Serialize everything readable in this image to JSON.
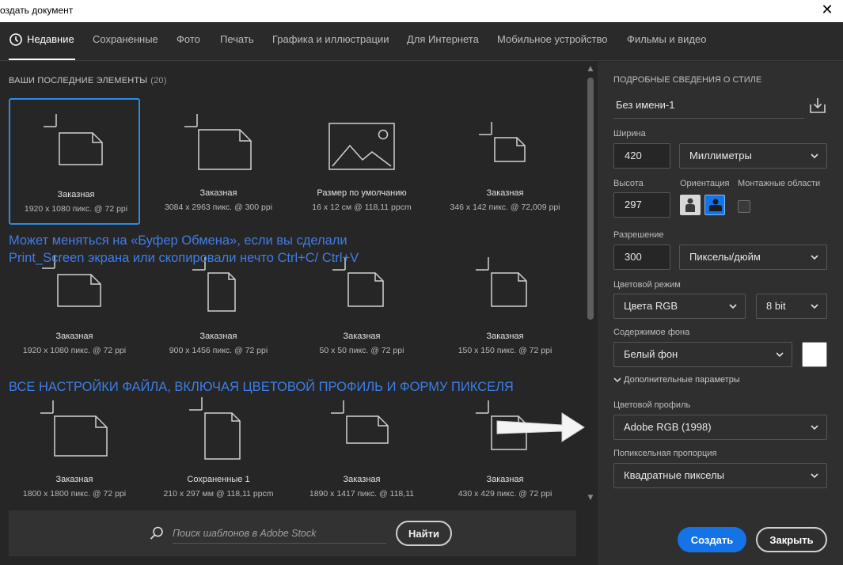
{
  "window": {
    "title": "оздать документ",
    "close_icon": "✕"
  },
  "tabs": [
    {
      "label": "Недавние",
      "active": true
    },
    {
      "label": "Сохраненные"
    },
    {
      "label": "Фото"
    },
    {
      "label": "Печать"
    },
    {
      "label": "Графика и иллюстрации"
    },
    {
      "label": "Для Интернета"
    },
    {
      "label": "Мобильное устройство"
    },
    {
      "label": "Фильмы и видео"
    }
  ],
  "recent": {
    "title": "ВАШИ ПОСЛЕДНИЕ ЭЛЕМЕНТЫ",
    "count": "(20)",
    "items": [
      {
        "name": "Заказная",
        "size": "1920 x 1080 пикс. @ 72 ppi",
        "icon": "landscape-document-icon",
        "selected": true
      },
      {
        "name": "Заказная",
        "size": "3084 x 2963 пикс. @ 300 ppi",
        "icon": "square-document-icon"
      },
      {
        "name": "Размер по умолчанию",
        "size": "16 x 12 см @ 118,11 ppcm",
        "icon": "image-placeholder-icon"
      },
      {
        "name": "Заказная",
        "size": "346 x 142 пикс. @ 72,009 ppi",
        "icon": "wide-document-icon"
      },
      {
        "name": "Заказная",
        "size": "1920 x 1080 пикс. @ 72 ppi",
        "icon": "landscape-document-icon"
      },
      {
        "name": "Заказная",
        "size": "900 x 1456 пикс. @ 72 ppi",
        "icon": "portrait-document-icon"
      },
      {
        "name": "Заказная",
        "size": "50 x 50 пикс. @ 72 ppi",
        "icon": "square-document-icon"
      },
      {
        "name": "Заказная",
        "size": "150 x 150 пикс. @ 72 ppi",
        "icon": "square-document-icon"
      },
      {
        "name": "Заказная",
        "size": "1800 x 1800 пикс. @ 72 ppi",
        "icon": "square-document-icon"
      },
      {
        "name": "Сохраненные 1",
        "size": "210 x 297 мм @ 118,11 ppcm",
        "icon": "portrait-document-icon"
      },
      {
        "name": "Заказная",
        "size": "1890 x 1417 пикс. @ 118,11",
        "icon": "landscape-document-icon"
      },
      {
        "name": "Заказная",
        "size": "430 x 429 пикс. @ 72 ppi",
        "icon": "square-document-icon"
      }
    ]
  },
  "annotations": {
    "clipboard_line1": "Может меняться на «Буфер Обмена», если вы сделали",
    "clipboard_line2": "Print_Screen экрана или скопировали нечто  Ctrl+C/ Ctrl+V",
    "settings_note": "ВСЕ НАСТРОЙКИ ФАЙЛА, ВКЛЮЧАЯ ЦВЕТОВОЙ ПРОФИЛЬ И ФОРМУ ПИКСЕЛЯ"
  },
  "search": {
    "placeholder": "Поиск шаблонов в Adobe Stock",
    "button": "Найти"
  },
  "details": {
    "section_title": "ПОДРОБНЫЕ СВЕДЕНИЯ О СТИЛЕ",
    "doc_name": "Без имени-1",
    "width_label": "Ширина",
    "width_value": "420",
    "width_unit": "Миллиметры",
    "height_label": "Высота",
    "height_value": "297",
    "orientation_label": "Ориентация",
    "artboards_label": "Монтажные области",
    "resolution_label": "Разрешение",
    "resolution_value": "300",
    "resolution_unit": "Пикселы/дюйм",
    "color_mode_label": "Цветовой режим",
    "color_mode": "Цвета RGB",
    "bit_depth": "8 bit",
    "background_label": "Содержимое фона",
    "background": "Белый фон",
    "advanced_label": "Дополнительные параметры",
    "profile_label": "Цветовой профиль",
    "profile": "Adobe RGB (1998)",
    "pixel_aspect_label": "Попиксельная пропорция",
    "pixel_aspect": "Квадратные пикселы",
    "create_button": "Создать",
    "close_button": "Закрыть"
  },
  "colors": {
    "accent": "#1473e6",
    "annotation": "#3f7de6",
    "selection": "#2b8ce8"
  }
}
